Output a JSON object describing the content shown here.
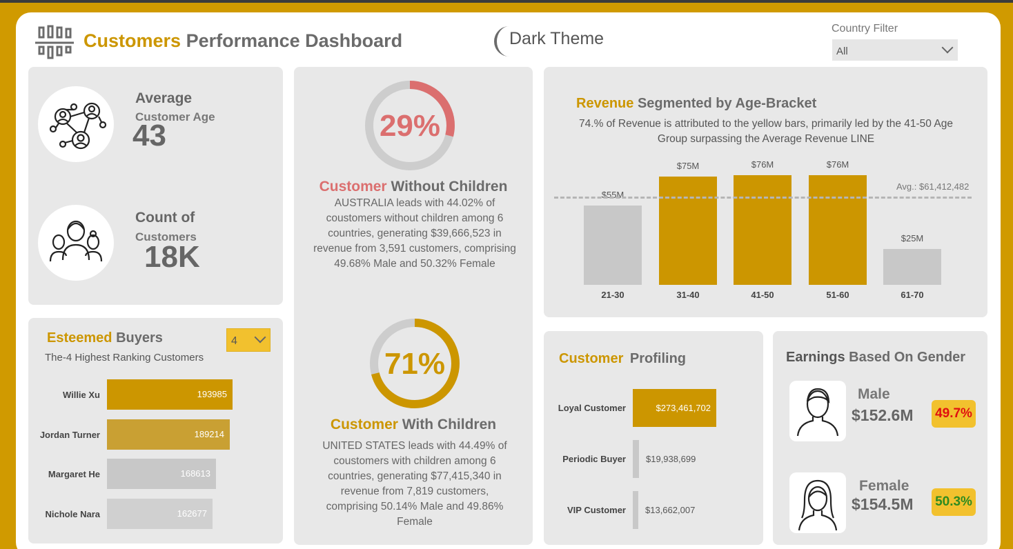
{
  "header": {
    "title_highlight": "Customers",
    "title_rest": "Performance Dashboard",
    "theme_toggle_label": "Dark Theme",
    "country_filter": {
      "label": "Country Filter",
      "selected": "All"
    }
  },
  "kpis": {
    "average_age": {
      "label": "Average",
      "sublabel": "Customer Age",
      "value": "43"
    },
    "customer_count": {
      "label": "Count of",
      "sublabel": "Customers",
      "value": "18K"
    }
  },
  "esteemed_buyers": {
    "title_highlight": "Esteemed",
    "title_rest": "Buyers",
    "top_n_selected": "4",
    "subtitle": "The-4 Highest Ranking Customers",
    "customers": [
      {
        "name": "Willie Xu",
        "value": "193985",
        "amount": 193985,
        "color": "#cc9600"
      },
      {
        "name": "Jordan Turner",
        "value": "189214",
        "amount": 189214,
        "color": "#c9a033"
      },
      {
        "name": "Margaret He",
        "value": "168613",
        "amount": 168613,
        "color": "#c8c8c8"
      },
      {
        "name": "Nichole Nara",
        "value": "162677",
        "amount": 162677,
        "color": "#d0d0d0"
      }
    ]
  },
  "without_children": {
    "percent_label": "29%",
    "percent": 29,
    "color": "#db6f6f",
    "title_highlight": "Customer",
    "title_rest": "Without Children",
    "description": "AUSTRALIA leads with 44.02% of coustomers without children among 6 countries, generating $39,666,523 in revenue from 3,591 customers, comprising 49.68% Male and 50.32% Female"
  },
  "with_children": {
    "percent_label": "71%",
    "percent": 71,
    "color": "#cc9600",
    "title_highlight": "Customer",
    "title_rest": "With Children",
    "description": "UNITED STATES leads with 44.49% of coustomers with children among 6 countries, generating $77,415,340 in revenue from 7,819 customers, comprising 50.14% Male and 49.86% Female"
  },
  "revenue_chart": {
    "title_highlight": "Revenue",
    "title_rest": "Segmented by Age-Bracket",
    "subtitle": "74.% of Revenue is attributed to the yellow bars, primarily led by the 41-50 Age Group surpassing the Average Revenue LINE",
    "average_label": "Avg.: $61,412,482"
  },
  "chart_data": {
    "type": "bar",
    "categories": [
      "21-30",
      "31-40",
      "41-50",
      "51-60",
      "61-70"
    ],
    "values": [
      55,
      75,
      76,
      76,
      25
    ],
    "data_labels": [
      "$55M",
      "$75M",
      "$76M",
      "$76M",
      "$25M"
    ],
    "bar_colors": [
      "#c8c8c8",
      "#cc9600",
      "#cc9600",
      "#cc9600",
      "#c8c8c8"
    ],
    "reference_line": {
      "value": 61.412482
    },
    "ylim": [
      0,
      76
    ],
    "grid": false
  },
  "profiling": {
    "title_highlight": "Customer",
    "title_rest": "Profiling",
    "segments": [
      {
        "name": "Loyal Customer",
        "value": "$273,461,702",
        "amount": 273461702
      },
      {
        "name": "Periodic Buyer",
        "value": "$19,938,699",
        "amount": 19938699
      },
      {
        "name": "VIP Customer",
        "value": "$13,662,007",
        "amount": 13662007
      }
    ]
  },
  "gender": {
    "title_highlight": "Earnings",
    "title_rest": "Based On Gender",
    "male": {
      "label": "Male",
      "value": "$152.6M",
      "share": "49.7%",
      "share_color": "#e01010"
    },
    "female": {
      "label": "Female",
      "value": "$154.5M",
      "share": "50.3%",
      "share_color": "#2e8b20"
    }
  }
}
